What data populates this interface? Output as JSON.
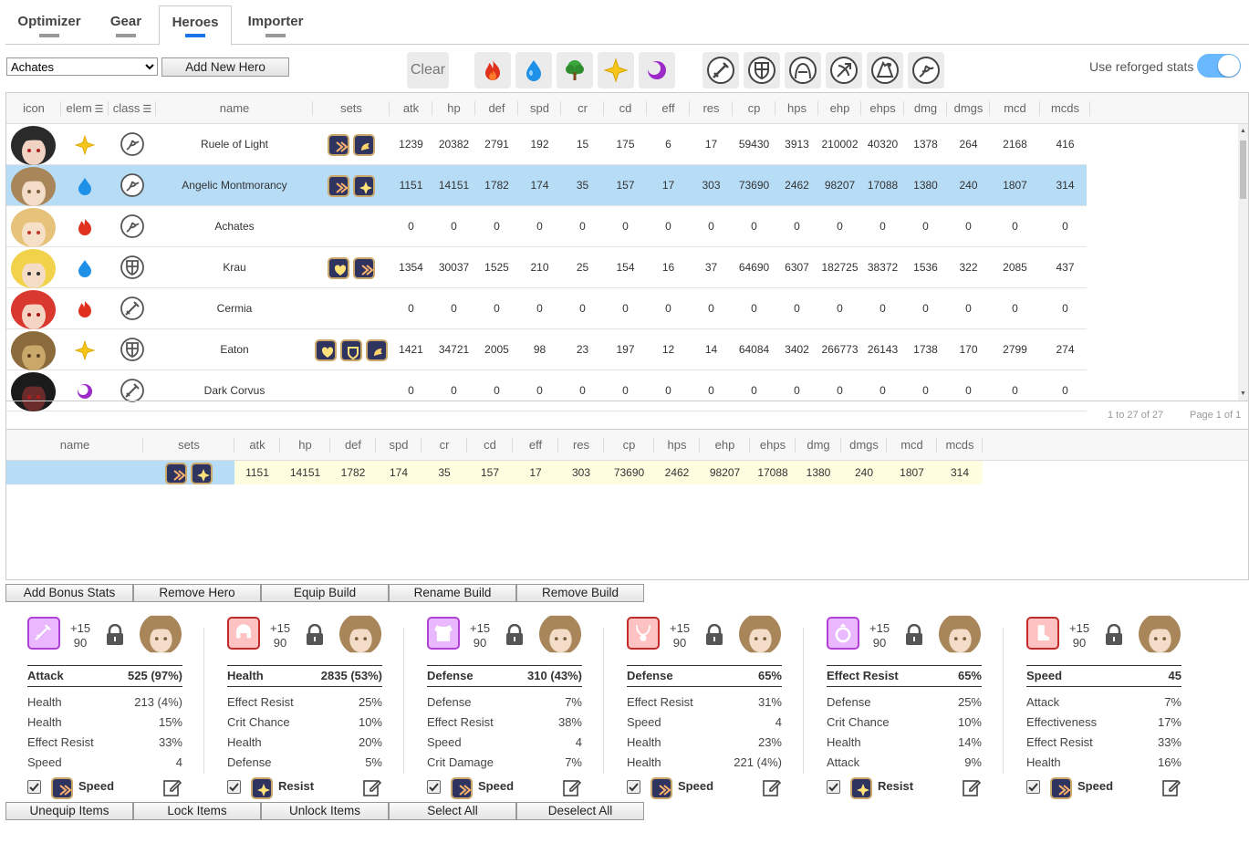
{
  "tabs": [
    {
      "label": "Optimizer",
      "active": false
    },
    {
      "label": "Gear",
      "active": false
    },
    {
      "label": "Heroes",
      "active": true
    },
    {
      "label": "Importer",
      "active": false
    }
  ],
  "toolbar": {
    "hero_select_value": "Achates",
    "add_new_hero": "Add New Hero",
    "clear": "Clear",
    "element_filters": [
      "fire-icon",
      "ice-icon",
      "earth-icon",
      "light-icon",
      "dark-icon"
    ],
    "class_filters": [
      "warrior-icon",
      "knight-icon",
      "thief-icon",
      "ranger-icon",
      "mage-icon",
      "soul-weaver-icon"
    ],
    "use_reforged_label": "Use reforged stats",
    "use_reforged_on": true
  },
  "hero_table": {
    "columns": [
      "icon",
      "elem",
      "class",
      "name",
      "sets",
      "atk",
      "hp",
      "def",
      "spd",
      "cr",
      "cd",
      "eff",
      "res",
      "cp",
      "hps",
      "ehp",
      "ehps",
      "dmg",
      "dmgs",
      "mcd",
      "mcds"
    ],
    "rows": [
      {
        "name": "Ruele of Light",
        "elem": "light",
        "class": "soul-weaver",
        "sets": [
          "speed",
          "counter"
        ],
        "atk": "1239",
        "hp": "20382",
        "def": "2791",
        "spd": "192",
        "cr": "15",
        "cd": "175",
        "eff": "6",
        "res": "17",
        "cp": "59430",
        "hps": "3913",
        "ehp": "210002",
        "ehps": "40320",
        "dmg": "1378",
        "dmgs": "264",
        "mcd": "2168",
        "mcds": "416",
        "selected": false
      },
      {
        "name": "Angelic Montmorancy",
        "elem": "ice",
        "class": "soul-weaver",
        "sets": [
          "speed",
          "resist"
        ],
        "atk": "1151",
        "hp": "14151",
        "def": "1782",
        "spd": "174",
        "cr": "35",
        "cd": "157",
        "eff": "17",
        "res": "303",
        "cp": "73690",
        "hps": "2462",
        "ehp": "98207",
        "ehps": "17088",
        "dmg": "1380",
        "dmgs": "240",
        "mcd": "1807",
        "mcds": "314",
        "selected": true
      },
      {
        "name": "Achates",
        "elem": "fire",
        "class": "soul-weaver",
        "sets": [],
        "atk": "0",
        "hp": "0",
        "def": "0",
        "spd": "0",
        "cr": "0",
        "cd": "0",
        "eff": "0",
        "res": "0",
        "cp": "0",
        "hps": "0",
        "ehp": "0",
        "ehps": "0",
        "dmg": "0",
        "dmgs": "0",
        "mcd": "0",
        "mcds": "0",
        "selected": false
      },
      {
        "name": "Krau",
        "elem": "ice",
        "class": "knight",
        "sets": [
          "immunity",
          "speed"
        ],
        "atk": "1354",
        "hp": "30037",
        "def": "1525",
        "spd": "210",
        "cr": "25",
        "cd": "154",
        "eff": "16",
        "res": "37",
        "cp": "64690",
        "hps": "6307",
        "ehp": "182725",
        "ehps": "38372",
        "dmg": "1536",
        "dmgs": "322",
        "mcd": "2085",
        "mcds": "437",
        "selected": false
      },
      {
        "name": "Cermia",
        "elem": "fire",
        "class": "warrior",
        "sets": [],
        "atk": "0",
        "hp": "0",
        "def": "0",
        "spd": "0",
        "cr": "0",
        "cd": "0",
        "eff": "0",
        "res": "0",
        "cp": "0",
        "hps": "0",
        "ehp": "0",
        "ehps": "0",
        "dmg": "0",
        "dmgs": "0",
        "mcd": "0",
        "mcds": "0",
        "selected": false
      },
      {
        "name": "Eaton",
        "elem": "light",
        "class": "knight",
        "sets": [
          "immunity",
          "defense",
          "counter"
        ],
        "atk": "1421",
        "hp": "34721",
        "def": "2005",
        "spd": "98",
        "cr": "23",
        "cd": "197",
        "eff": "12",
        "res": "14",
        "cp": "64084",
        "hps": "3402",
        "ehp": "266773",
        "ehps": "26143",
        "dmg": "1738",
        "dmgs": "170",
        "mcd": "2799",
        "mcds": "274",
        "selected": false
      },
      {
        "name": "Dark Corvus",
        "elem": "dark",
        "class": "warrior",
        "sets": [],
        "atk": "0",
        "hp": "0",
        "def": "0",
        "spd": "0",
        "cr": "0",
        "cd": "0",
        "eff": "0",
        "res": "0",
        "cp": "0",
        "hps": "0",
        "ehp": "0",
        "ehps": "0",
        "dmg": "0",
        "dmgs": "0",
        "mcd": "0",
        "mcds": "0",
        "selected": false
      }
    ],
    "pager_count": "1 to 27 of 27",
    "pager_page": "Page 1 of 1"
  },
  "build_table": {
    "columns": [
      "name",
      "sets",
      "atk",
      "hp",
      "def",
      "spd",
      "cr",
      "cd",
      "eff",
      "res",
      "cp",
      "hps",
      "ehp",
      "ehps",
      "dmg",
      "dmgs",
      "mcd",
      "mcds"
    ],
    "rows": [
      {
        "name": "",
        "sets": [
          "speed",
          "resist"
        ],
        "atk": "1151",
        "hp": "14151",
        "def": "1782",
        "spd": "174",
        "cr": "35",
        "cd": "157",
        "eff": "17",
        "res": "303",
        "cp": "73690",
        "hps": "2462",
        "ehp": "98207",
        "ehps": "17088",
        "dmg": "1380",
        "dmgs": "240",
        "mcd": "1807",
        "mcds": "314"
      }
    ]
  },
  "build_buttons": [
    "Add Bonus Stats",
    "Remove Hero",
    "Equip Build",
    "Rename Build",
    "Remove Build"
  ],
  "gear": [
    {
      "slot": "weapon",
      "enhance": "+15",
      "level": "90",
      "main_label": "Attack",
      "main_value": "525 (97%)",
      "subs": [
        [
          "Health",
          "213 (4%)"
        ],
        [
          "Health",
          "15%"
        ],
        [
          "Effect Resist",
          "33%"
        ],
        [
          "Speed",
          "4"
        ]
      ],
      "set": "Speed",
      "rarity_color": "#e9b8ff"
    },
    {
      "slot": "helmet",
      "enhance": "+15",
      "level": "90",
      "main_label": "Health",
      "main_value": "2835 (53%)",
      "subs": [
        [
          "Effect Resist",
          "25%"
        ],
        [
          "Crit Chance",
          "10%"
        ],
        [
          "Health",
          "20%"
        ],
        [
          "Defense",
          "5%"
        ]
      ],
      "set": "Resist",
      "rarity_color": "#ffc2c2"
    },
    {
      "slot": "armor",
      "enhance": "+15",
      "level": "90",
      "main_label": "Defense",
      "main_value": "310 (43%)",
      "subs": [
        [
          "Defense",
          "7%"
        ],
        [
          "Effect Resist",
          "38%"
        ],
        [
          "Speed",
          "4"
        ],
        [
          "Crit Damage",
          "7%"
        ]
      ],
      "set": "Speed",
      "rarity_color": "#e9b8ff"
    },
    {
      "slot": "necklace",
      "enhance": "+15",
      "level": "90",
      "main_label": "Defense",
      "main_value": "65%",
      "subs": [
        [
          "Effect Resist",
          "31%"
        ],
        [
          "Speed",
          "4"
        ],
        [
          "Health",
          "23%"
        ],
        [
          "Health",
          "221 (4%)"
        ]
      ],
      "set": "Speed",
      "rarity_color": "#ffc2c2"
    },
    {
      "slot": "ring",
      "enhance": "+15",
      "level": "90",
      "main_label": "Effect Resist",
      "main_value": "65%",
      "subs": [
        [
          "Defense",
          "25%"
        ],
        [
          "Crit Chance",
          "10%"
        ],
        [
          "Health",
          "14%"
        ],
        [
          "Attack",
          "9%"
        ]
      ],
      "set": "Resist",
      "rarity_color": "#e9b8ff"
    },
    {
      "slot": "boots",
      "enhance": "+15",
      "level": "90",
      "main_label": "Speed",
      "main_value": "45",
      "subs": [
        [
          "Attack",
          "7%"
        ],
        [
          "Effectiveness",
          "17%"
        ],
        [
          "Effect Resist",
          "33%"
        ],
        [
          "Health",
          "16%"
        ]
      ],
      "set": "Speed",
      "rarity_color": "#ffc2c2"
    }
  ],
  "gear_buttons": [
    "Unequip Items",
    "Lock Items",
    "Unlock Items",
    "Select All",
    "Deselect All"
  ]
}
